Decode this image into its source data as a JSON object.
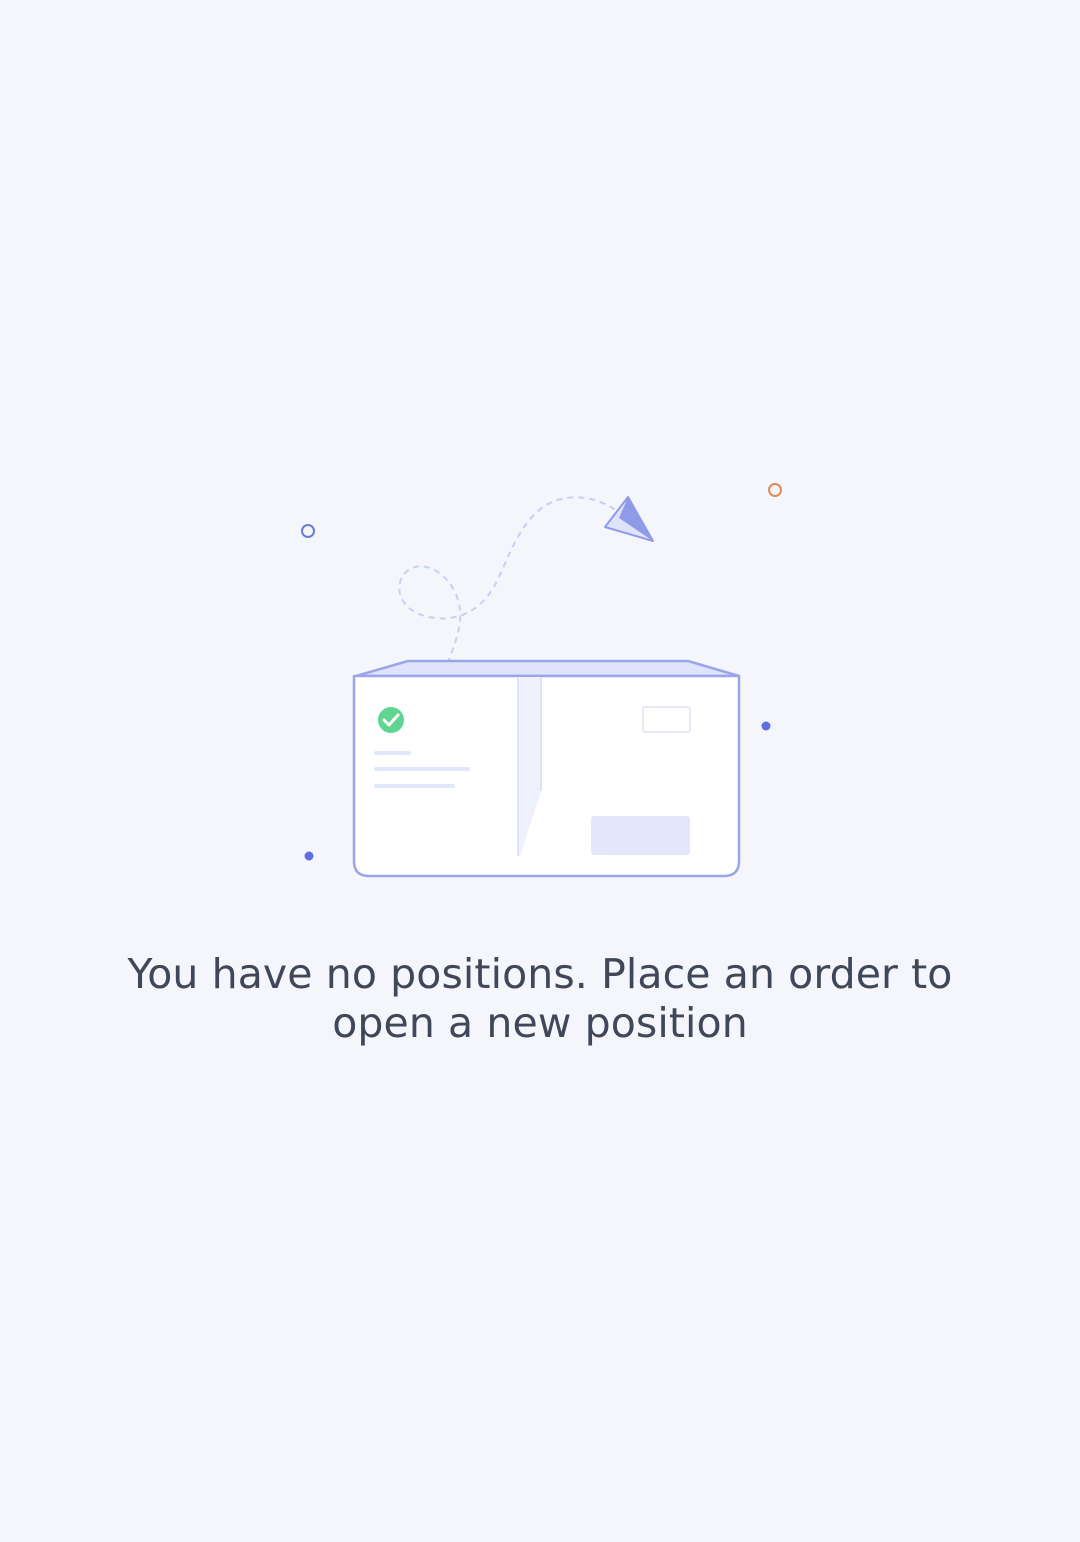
{
  "empty_state": {
    "message": "You have no positions. Place an order to open a new position",
    "illustration": {
      "name": "empty-box-with-paper-plane",
      "icons": [
        "paper-plane-icon",
        "check-circle-icon",
        "box-icon"
      ],
      "colors": {
        "background": "#f4f6fb",
        "outline": "#9aa5ea",
        "flap": "#dfe3fb",
        "check": "#5fd68f",
        "dot_blue": "#5b6fe0",
        "ring_orange": "#e08a5a",
        "ring_blue": "#6b7ed6",
        "placeholder": "#e3e7fb",
        "text": "#3f4758"
      }
    }
  }
}
